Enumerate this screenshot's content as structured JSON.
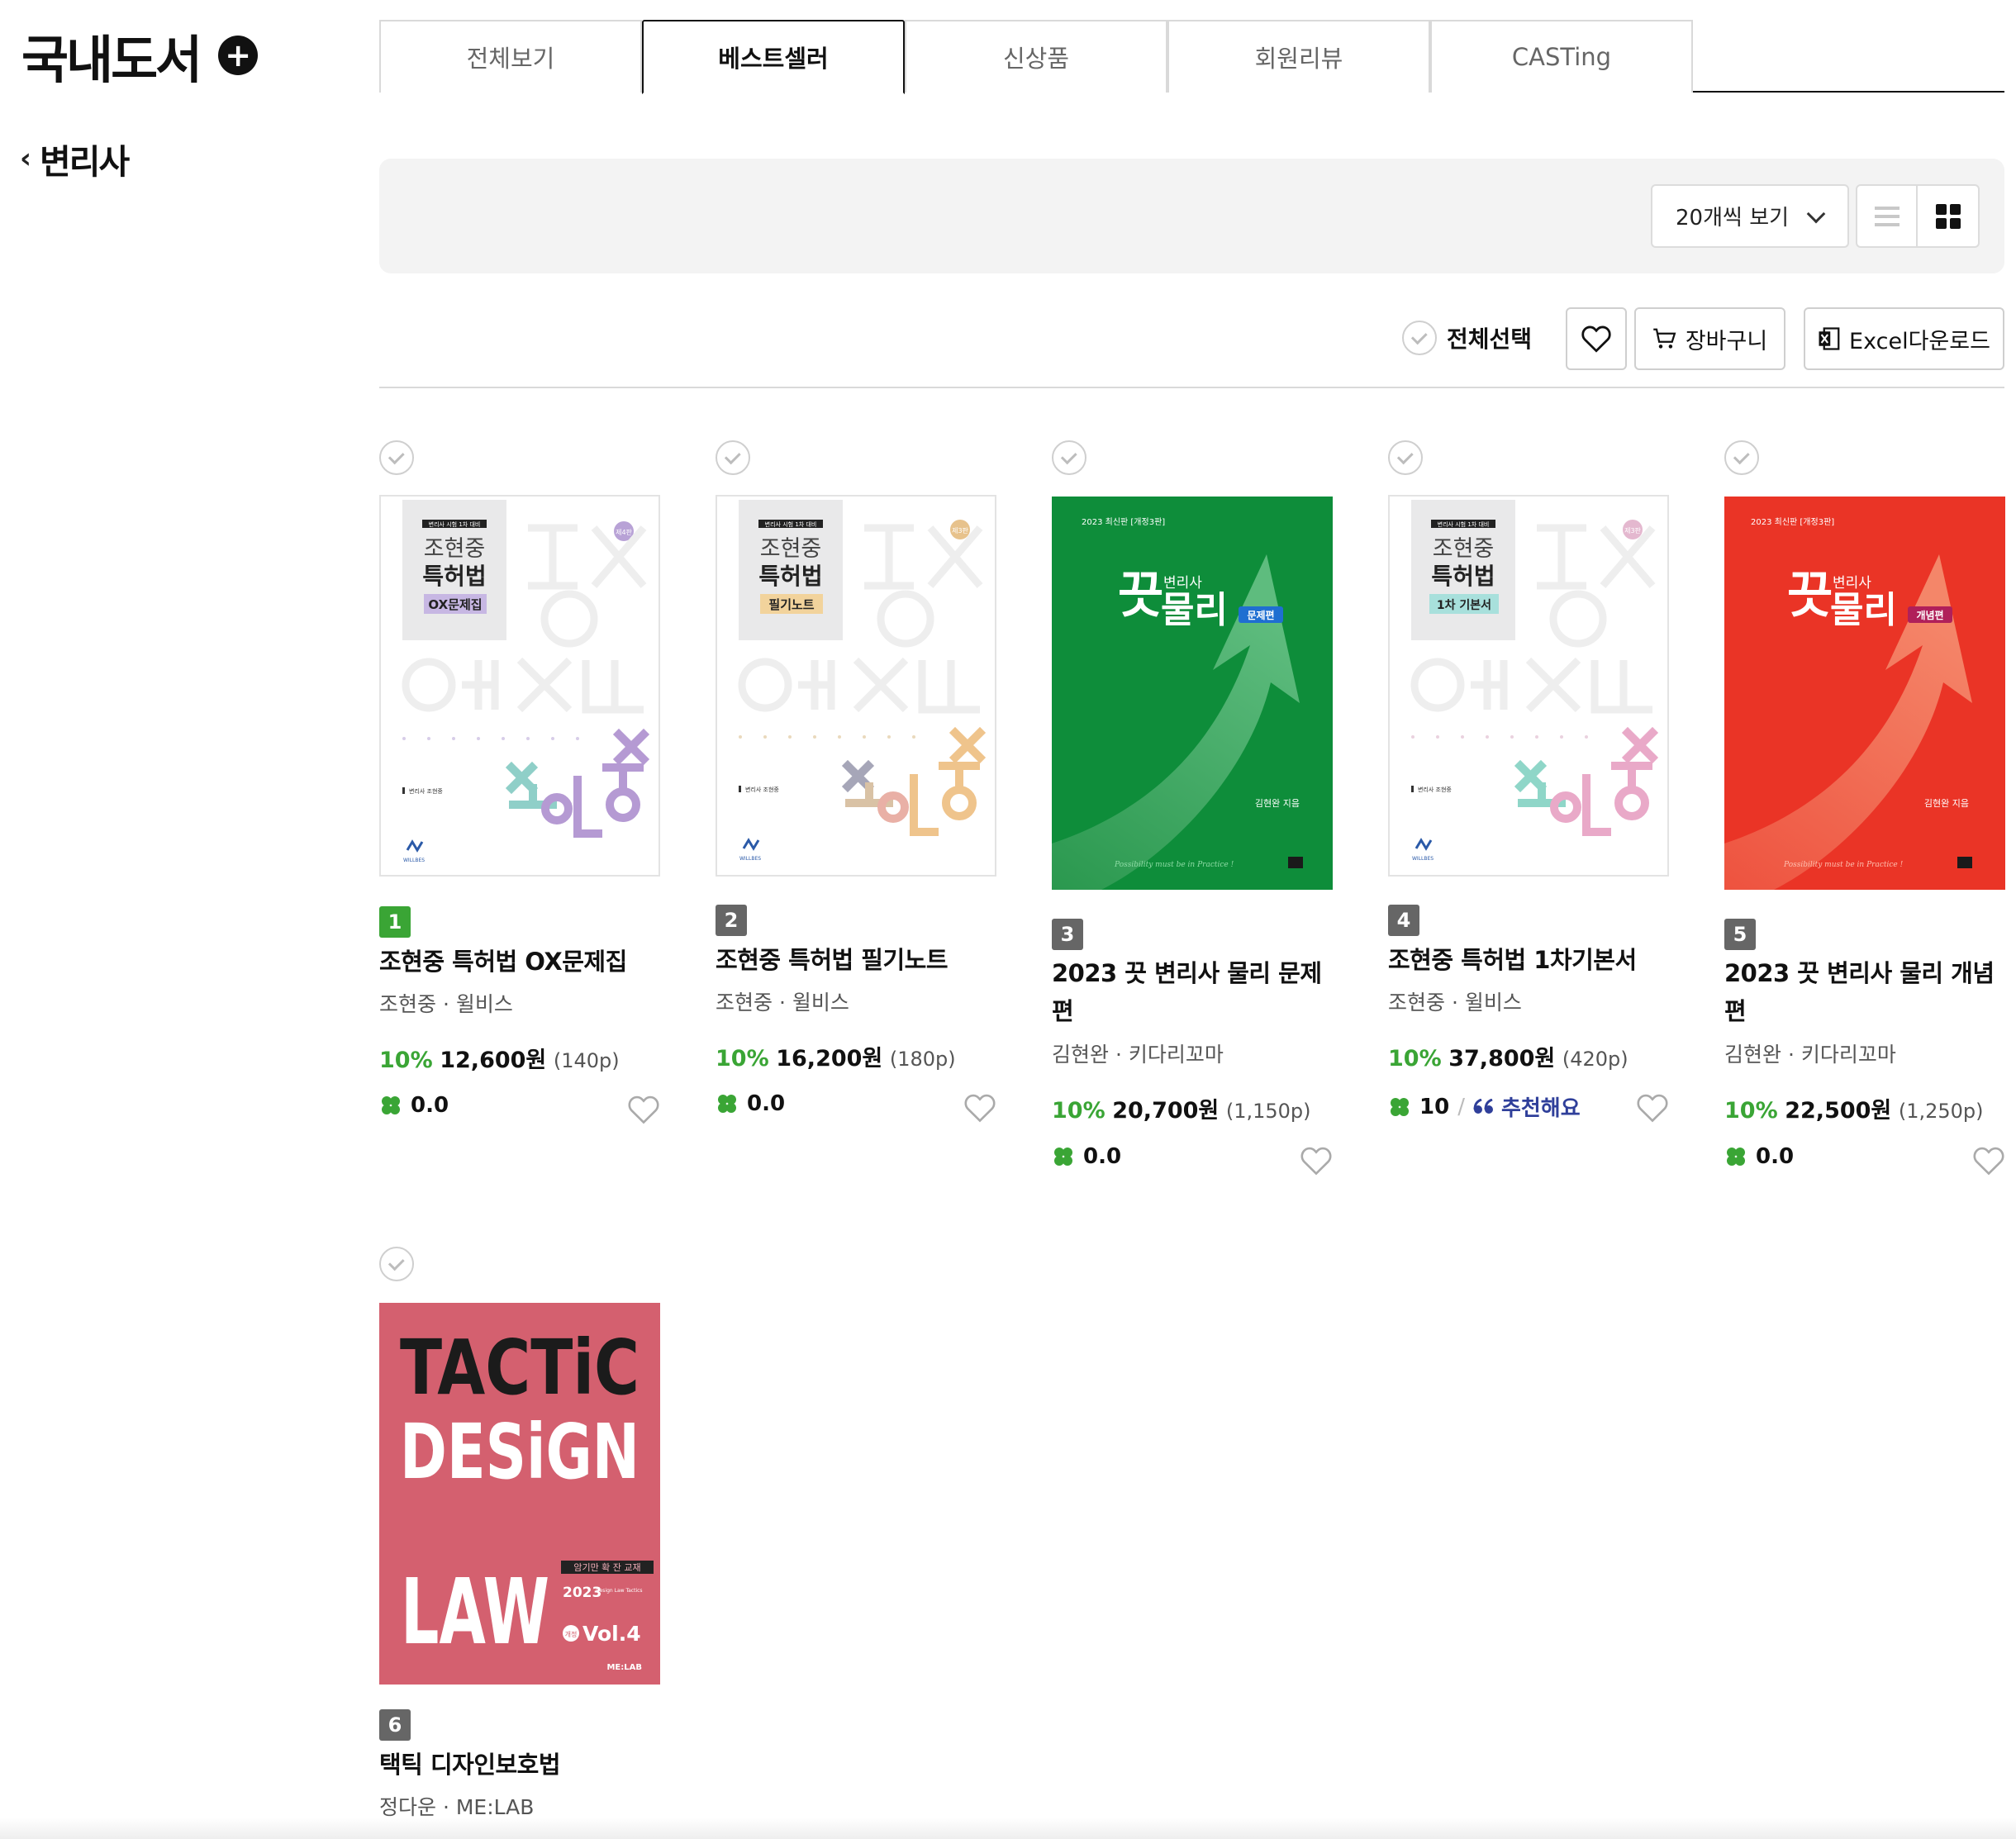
{
  "sidebar": {
    "category_title": "국내도서",
    "back_label": "변리사"
  },
  "tabs": [
    {
      "label": "전체보기",
      "active": false
    },
    {
      "label": "베스트셀러",
      "active": true
    },
    {
      "label": "신상품",
      "active": false
    },
    {
      "label": "회원리뷰",
      "active": false
    },
    {
      "label": "CASTing",
      "active": false
    }
  ],
  "toolbar": {
    "page_size_selected": "20개씩 보기",
    "view_mode": "grid"
  },
  "actions": {
    "select_all_label": "전체선택",
    "cart_label": "장바구니",
    "excel_label": "Excel다운로드"
  },
  "colors": {
    "accent_green": "#3aa535",
    "recommend_blue": "#2f3f9a",
    "rank_grey": "#666666"
  },
  "products": [
    {
      "rank": "1",
      "title": "조현중 특허법 OX문제집",
      "author_publisher": "조현중 · 윌비스",
      "discount": "10%",
      "price": "12,600원",
      "pages": "(140p)",
      "rating": "0.0",
      "cover": {
        "series_top": "변리사 시험 1차 대비",
        "title_line1": "조현중",
        "title_line2": "특허법",
        "tag": "OX문제집",
        "edition": "제4판",
        "author_small": "변리사 조현중",
        "publisher_logo": "WILLBES"
      }
    },
    {
      "rank": "2",
      "title": "조현중 특허법 필기노트",
      "author_publisher": "조현중 · 윌비스",
      "discount": "10%",
      "price": "16,200원",
      "pages": "(180p)",
      "rating": "0.0",
      "cover": {
        "series_top": "변리사 시험 1차 대비",
        "title_line1": "조현중",
        "title_line2": "특허법",
        "tag": "필기노트",
        "edition": "제3판",
        "author_small": "변리사 조현중",
        "publisher_logo": "WILLBES"
      }
    },
    {
      "rank": "3",
      "title": "2023 끗 변리사 물리 문제편",
      "author_publisher": "김현완 · 키다리꼬마",
      "discount": "10%",
      "price": "20,700원",
      "pages": "(1,150p)",
      "rating": "0.0",
      "cover": {
        "top": "2023 최신판 [개정3판]",
        "big1": "끗",
        "small": "변리사",
        "big2": "물리",
        "tag": "문제편",
        "author": "김현완 지음",
        "motto": "Possibility must be in Practice !"
      }
    },
    {
      "rank": "4",
      "title": "조현중 특허법 1차기본서",
      "author_publisher": "조현중 · 윌비스",
      "discount": "10%",
      "price": "37,800원",
      "pages": "(420p)",
      "rating": "10",
      "recommend": "추천해요",
      "cover": {
        "series_top": "변리사 시험 1차 대비",
        "title_line1": "조현중",
        "title_line2": "특허법",
        "tag": "1차 기본서",
        "edition": "제3판",
        "author_small": "변리사 조현중",
        "publisher_logo": "WILLBES"
      }
    },
    {
      "rank": "5",
      "title": "2023 끗 변리사 물리 개념편",
      "author_publisher": "김현완 · 키다리꼬마",
      "discount": "10%",
      "price": "22,500원",
      "pages": "(1,250p)",
      "rating": "0.0",
      "cover": {
        "top": "2023 최신판 [개정3판]",
        "big1": "끗",
        "small": "변리사",
        "big2": "물리",
        "tag": "개념편",
        "author": "김현완 지음",
        "motto": "Possibility must be in Practice !"
      }
    },
    {
      "rank": "6",
      "title": "택틱 디자인보호법",
      "author_publisher": "정다운 · ME:LAB",
      "cover": {
        "line1": "TACTiC",
        "line2": "DESiGN",
        "line3": "LAW",
        "tag": "암기만 확 잔 교재",
        "year": "2023",
        "sub": "Design Law Tactics",
        "vol": "Vol.4",
        "edition": "개정",
        "publisher": "ME:LAB"
      }
    }
  ]
}
